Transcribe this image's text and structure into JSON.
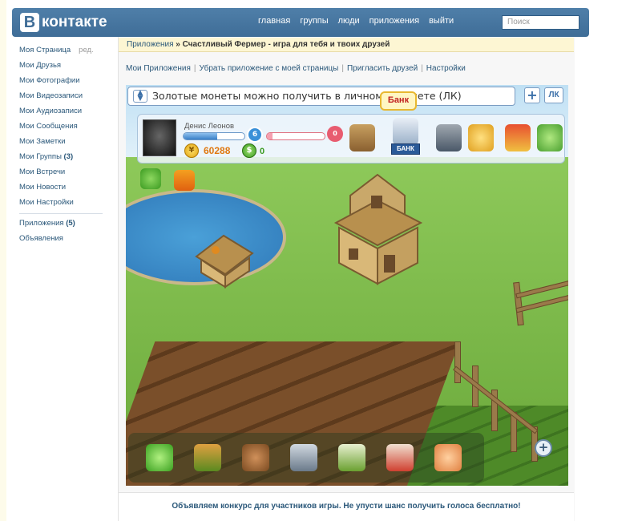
{
  "header": {
    "logo_letter": "В",
    "logo_text": "контакте",
    "nav": [
      "главная",
      "группы",
      "люди",
      "приложения",
      "выйти"
    ],
    "search_placeholder": "Поиск"
  },
  "sidebar": {
    "items": [
      {
        "label": "Моя Страница",
        "extra": "ред."
      },
      {
        "label": "Мои Друзья"
      },
      {
        "label": "Мои Фотографии"
      },
      {
        "label": "Мои Видеозаписи"
      },
      {
        "label": "Мои Аудиозаписи"
      },
      {
        "label": "Мои Сообщения"
      },
      {
        "label": "Мои Заметки"
      },
      {
        "label": "Мои Группы",
        "count": "(3)"
      },
      {
        "label": "Мои Встречи"
      },
      {
        "label": "Мои Новости"
      },
      {
        "label": "Мои Настройки"
      }
    ],
    "secondary": [
      {
        "label": "Приложения",
        "count": "(5)"
      },
      {
        "label": "Объявления"
      }
    ]
  },
  "app_header": {
    "crumb": "Приложения",
    "separator": "»",
    "title": "Счастливый Фермер - игра для тебя и твоих друзей"
  },
  "app_links": [
    "Мои Приложения",
    "Убрать приложение с моей страницы",
    "Пригласить друзей",
    "Настройки"
  ],
  "game": {
    "notice": "Золотые монеты можно получить в личном кабинете (ЛК)",
    "plus_button": "+",
    "lk_button": "ЛК",
    "bank_tooltip": "Банк",
    "bank_label": "БАНК",
    "player": {
      "name": "Денис Леонов",
      "level": "6",
      "xp_fraction": 0.55,
      "hp_fraction": 0.1,
      "hp_value": "0",
      "coins": "60288",
      "green_currency": "0"
    },
    "top_tools": [
      "watering-can-icon",
      "bank-icon",
      "tools-icon",
      "cupcake-icon",
      "shop-icon",
      "friends-icon"
    ],
    "bottom_tools": [
      "pointer-icon",
      "shovel-icon",
      "seed-bag-icon",
      "watering-can-icon",
      "fertilizer-icon",
      "pesticide-icon",
      "hand-icon"
    ],
    "zoom_button": "+"
  },
  "footer": {
    "promo": "Объявляем конкурс для участников игры. Не упусти шанс получить голоса бесплатно!"
  }
}
